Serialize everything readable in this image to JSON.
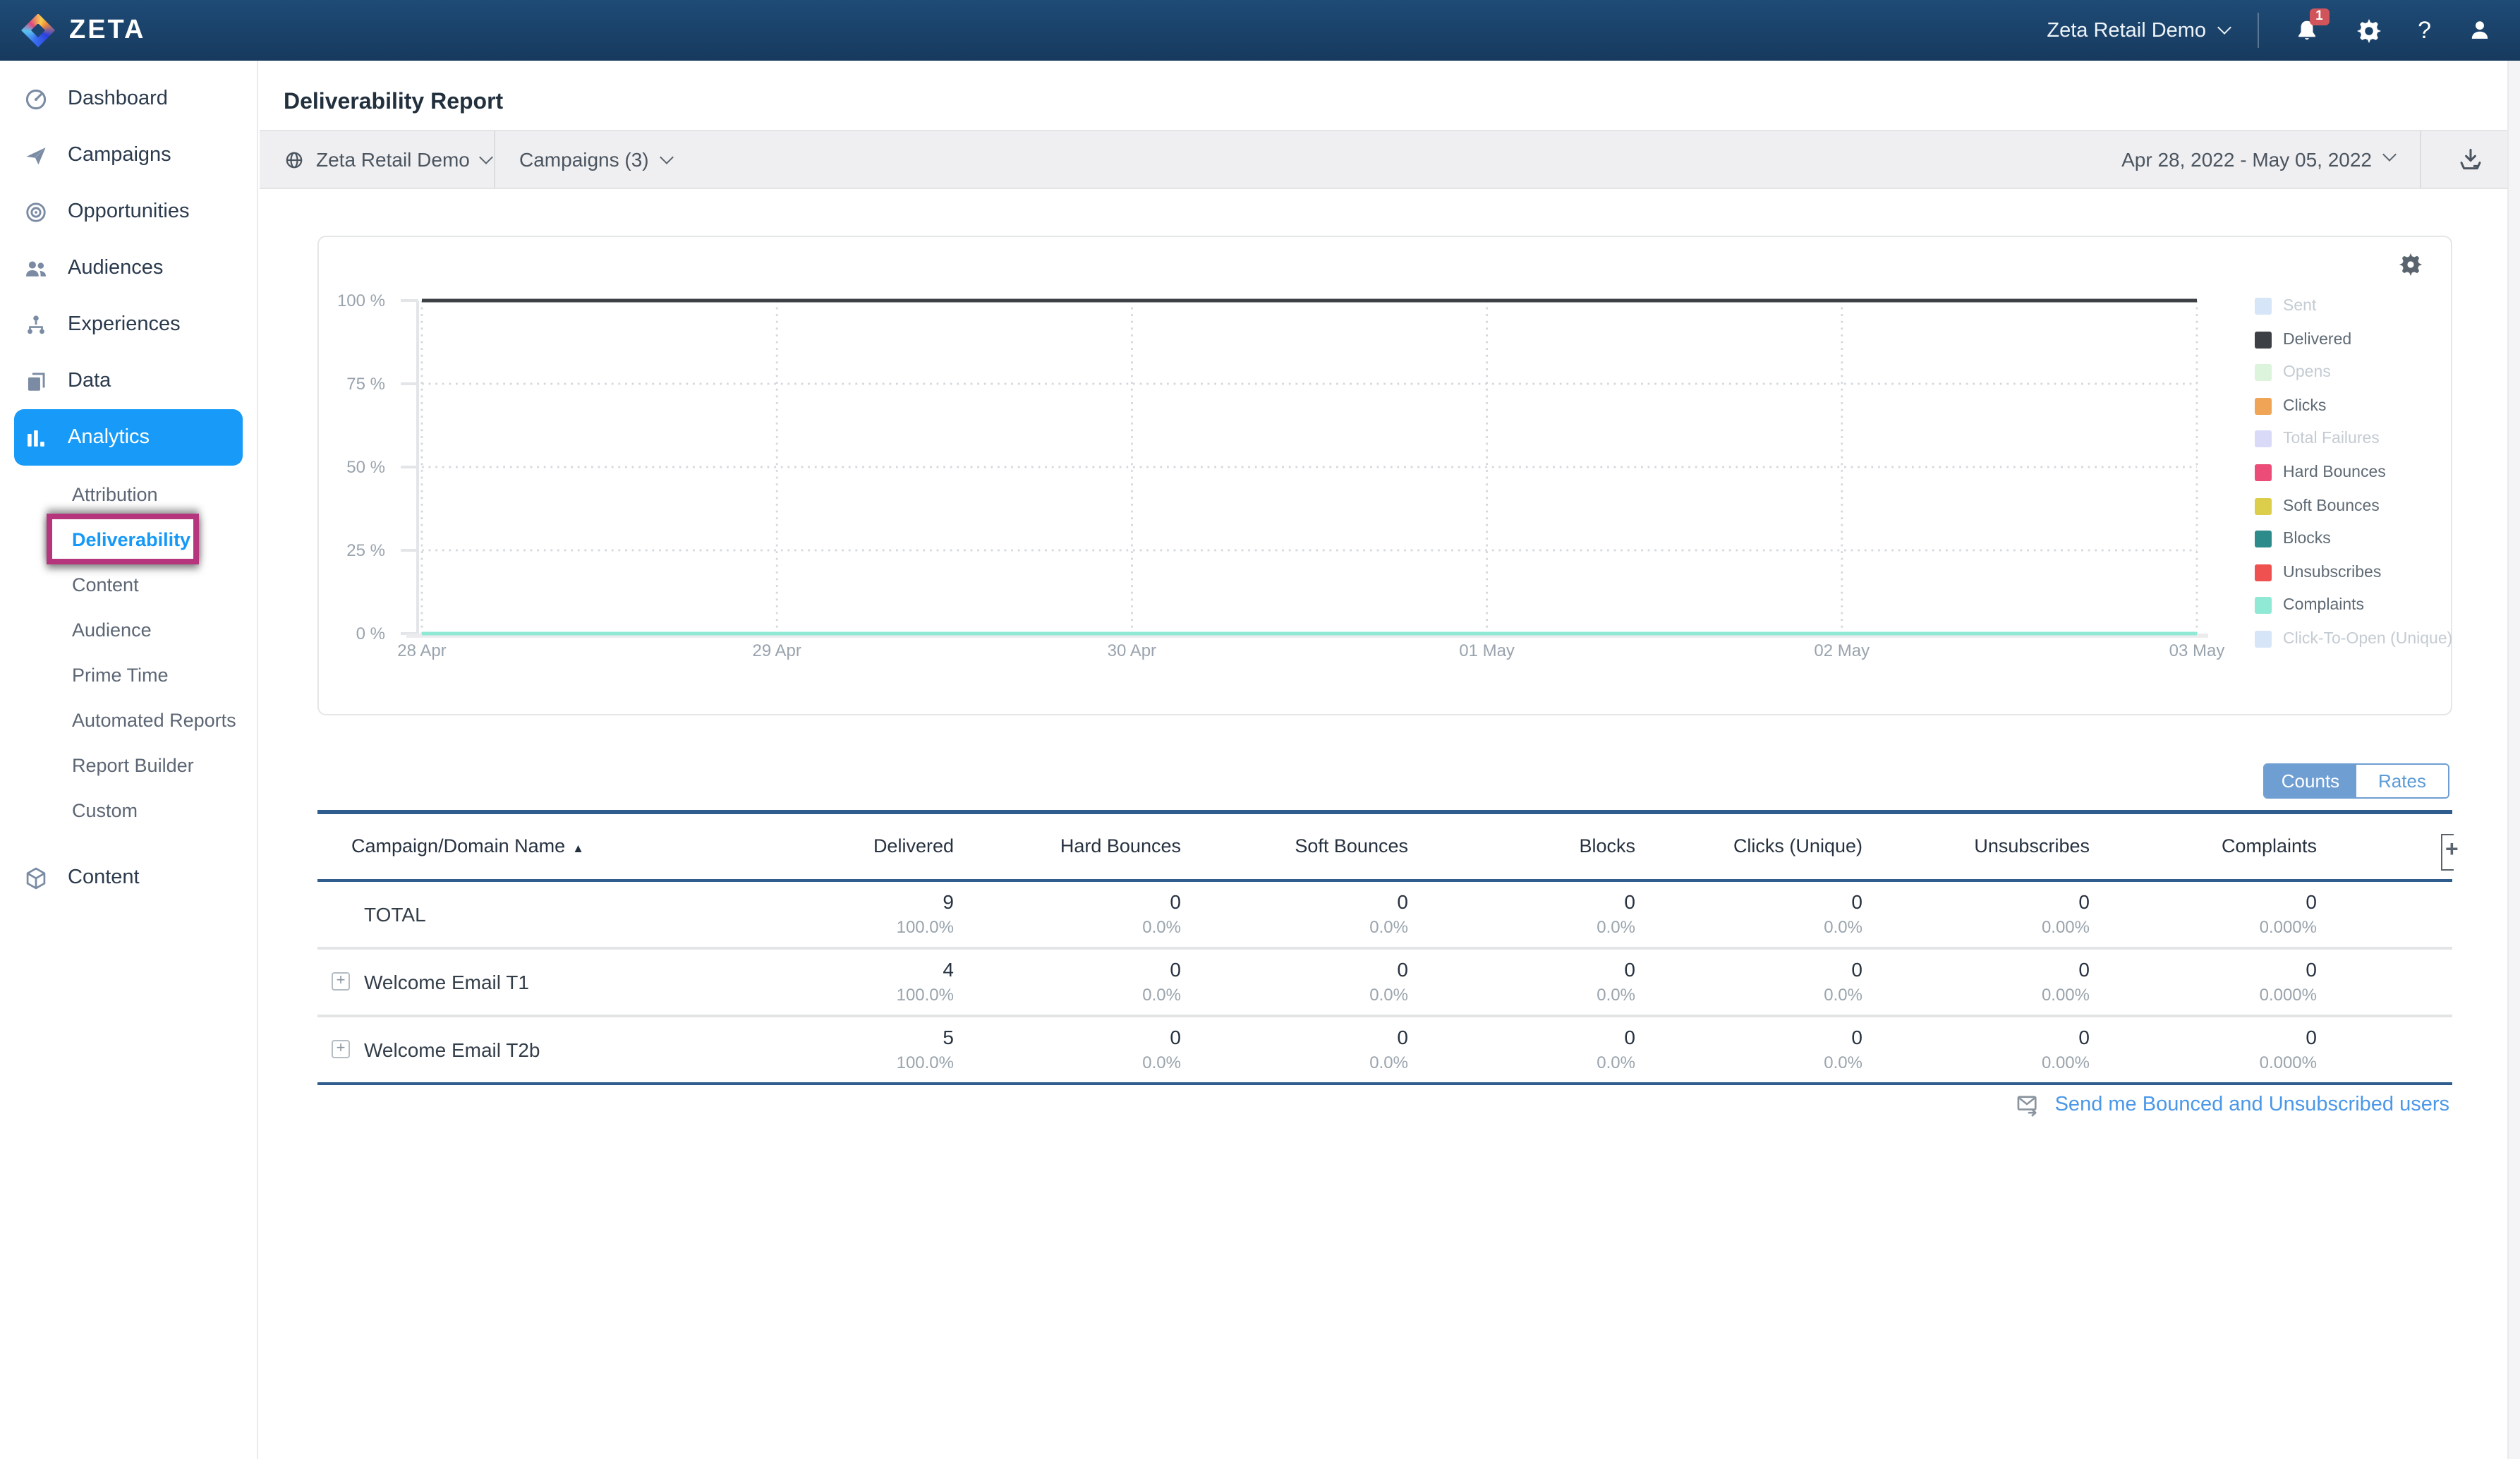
{
  "topbar": {
    "brand": "ZETA",
    "account": "Zeta Retail Demo",
    "notification_count": "1"
  },
  "sidebar": {
    "main_top": [
      {
        "label": "Dashboard",
        "icon": "dashboard-icon"
      },
      {
        "label": "Campaigns",
        "icon": "campaigns-icon"
      },
      {
        "label": "Opportunities",
        "icon": "opportunities-icon"
      },
      {
        "label": "Audiences",
        "icon": "audiences-icon"
      },
      {
        "label": "Experiences",
        "icon": "experiences-icon"
      },
      {
        "label": "Data",
        "icon": "data-icon"
      },
      {
        "label": "Analytics",
        "icon": "analytics-icon",
        "active": true
      }
    ],
    "analytics_sub": [
      {
        "label": "Attribution"
      },
      {
        "label": "Deliverability",
        "active": true,
        "annotated": true
      },
      {
        "label": "Content"
      },
      {
        "label": "Audience"
      },
      {
        "label": "Prime Time"
      },
      {
        "label": "Automated Reports"
      },
      {
        "label": "Report Builder"
      },
      {
        "label": "Custom"
      }
    ],
    "main_bottom": [
      {
        "label": "Content",
        "icon": "content-icon"
      }
    ]
  },
  "page": {
    "title": "Deliverability Report"
  },
  "filters": {
    "account": "Zeta Retail Demo",
    "campaigns": "Campaigns (3)",
    "date_range": "Apr 28, 2022  - May 05, 2022"
  },
  "chart_data": {
    "type": "line",
    "title": "",
    "x": [
      "28 Apr",
      "29 Apr",
      "30 Apr",
      "01 May",
      "02 May",
      "03 May"
    ],
    "y_ticks": [
      "100 %",
      "75 %",
      "50 %",
      "25 %",
      "0 %"
    ],
    "ylim": [
      0,
      100
    ],
    "grid": "dotted",
    "legend_position": "right",
    "series": [
      {
        "name": "Sent",
        "color": "#d6e5f8",
        "hidden": true
      },
      {
        "name": "Delivered",
        "color": "#3d4145",
        "values": [
          100,
          100,
          100,
          100,
          100,
          100
        ]
      },
      {
        "name": "Opens",
        "color": "#dcf3dc",
        "hidden": true
      },
      {
        "name": "Clicks",
        "color": "#f0a456",
        "values": [
          0,
          0,
          0,
          0,
          0,
          0
        ]
      },
      {
        "name": "Total Failures",
        "color": "#d9daf7",
        "hidden": true
      },
      {
        "name": "Hard Bounces",
        "color": "#eb4d78",
        "values": [
          0,
          0,
          0,
          0,
          0,
          0
        ]
      },
      {
        "name": "Soft Bounces",
        "color": "#dcce4a",
        "values": [
          0,
          0,
          0,
          0,
          0,
          0
        ]
      },
      {
        "name": "Blocks",
        "color": "#2e8b8b",
        "values": [
          0,
          0,
          0,
          0,
          0,
          0
        ]
      },
      {
        "name": "Unsubscribes",
        "color": "#ef5150",
        "values": [
          0,
          0,
          0,
          0,
          0,
          0
        ]
      },
      {
        "name": "Complaints",
        "color": "#8fe9d4",
        "values": [
          0,
          0,
          0,
          0,
          0,
          0
        ]
      },
      {
        "name": "Click-To-Open (Unique)",
        "color": "#d6e5f8",
        "hidden": true
      }
    ]
  },
  "toggle": {
    "counts": "Counts",
    "rates": "Rates",
    "selected": "Counts"
  },
  "table": {
    "name_column": "Campaign/Domain Name",
    "sort": "asc",
    "columns": [
      "Delivered",
      "Hard Bounces",
      "Soft Bounces",
      "Blocks",
      "Clicks (Unique)",
      "Unsubscribes",
      "Complaints"
    ],
    "rows": [
      {
        "name": "TOTAL",
        "expandable": false,
        "cells": [
          {
            "value": "9",
            "rate": "100.0%"
          },
          {
            "value": "0",
            "rate": "0.0%"
          },
          {
            "value": "0",
            "rate": "0.0%"
          },
          {
            "value": "0",
            "rate": "0.0%"
          },
          {
            "value": "0",
            "rate": "0.0%"
          },
          {
            "value": "0",
            "rate": "0.00%"
          },
          {
            "value": "0",
            "rate": "0.000%"
          }
        ]
      },
      {
        "name": "Welcome Email T1",
        "expandable": true,
        "cells": [
          {
            "value": "4",
            "rate": "100.0%"
          },
          {
            "value": "0",
            "rate": "0.0%"
          },
          {
            "value": "0",
            "rate": "0.0%"
          },
          {
            "value": "0",
            "rate": "0.0%"
          },
          {
            "value": "0",
            "rate": "0.0%"
          },
          {
            "value": "0",
            "rate": "0.00%"
          },
          {
            "value": "0",
            "rate": "0.000%"
          }
        ]
      },
      {
        "name": "Welcome Email T2b",
        "expandable": true,
        "cells": [
          {
            "value": "5",
            "rate": "100.0%"
          },
          {
            "value": "0",
            "rate": "0.0%"
          },
          {
            "value": "0",
            "rate": "0.0%"
          },
          {
            "value": "0",
            "rate": "0.0%"
          },
          {
            "value": "0",
            "rate": "0.0%"
          },
          {
            "value": "0",
            "rate": "0.00%"
          },
          {
            "value": "0",
            "rate": "0.000%"
          }
        ]
      }
    ]
  },
  "footer": {
    "link": "Send me Bounced and Unsubscribed users"
  },
  "colors": {
    "accent": "#189af8",
    "annotation": "#b5367d",
    "table_line": "#2e5d8e",
    "link": "#4a97e8",
    "toggle_button": "#6f9ed3",
    "badge": "#d05459"
  }
}
